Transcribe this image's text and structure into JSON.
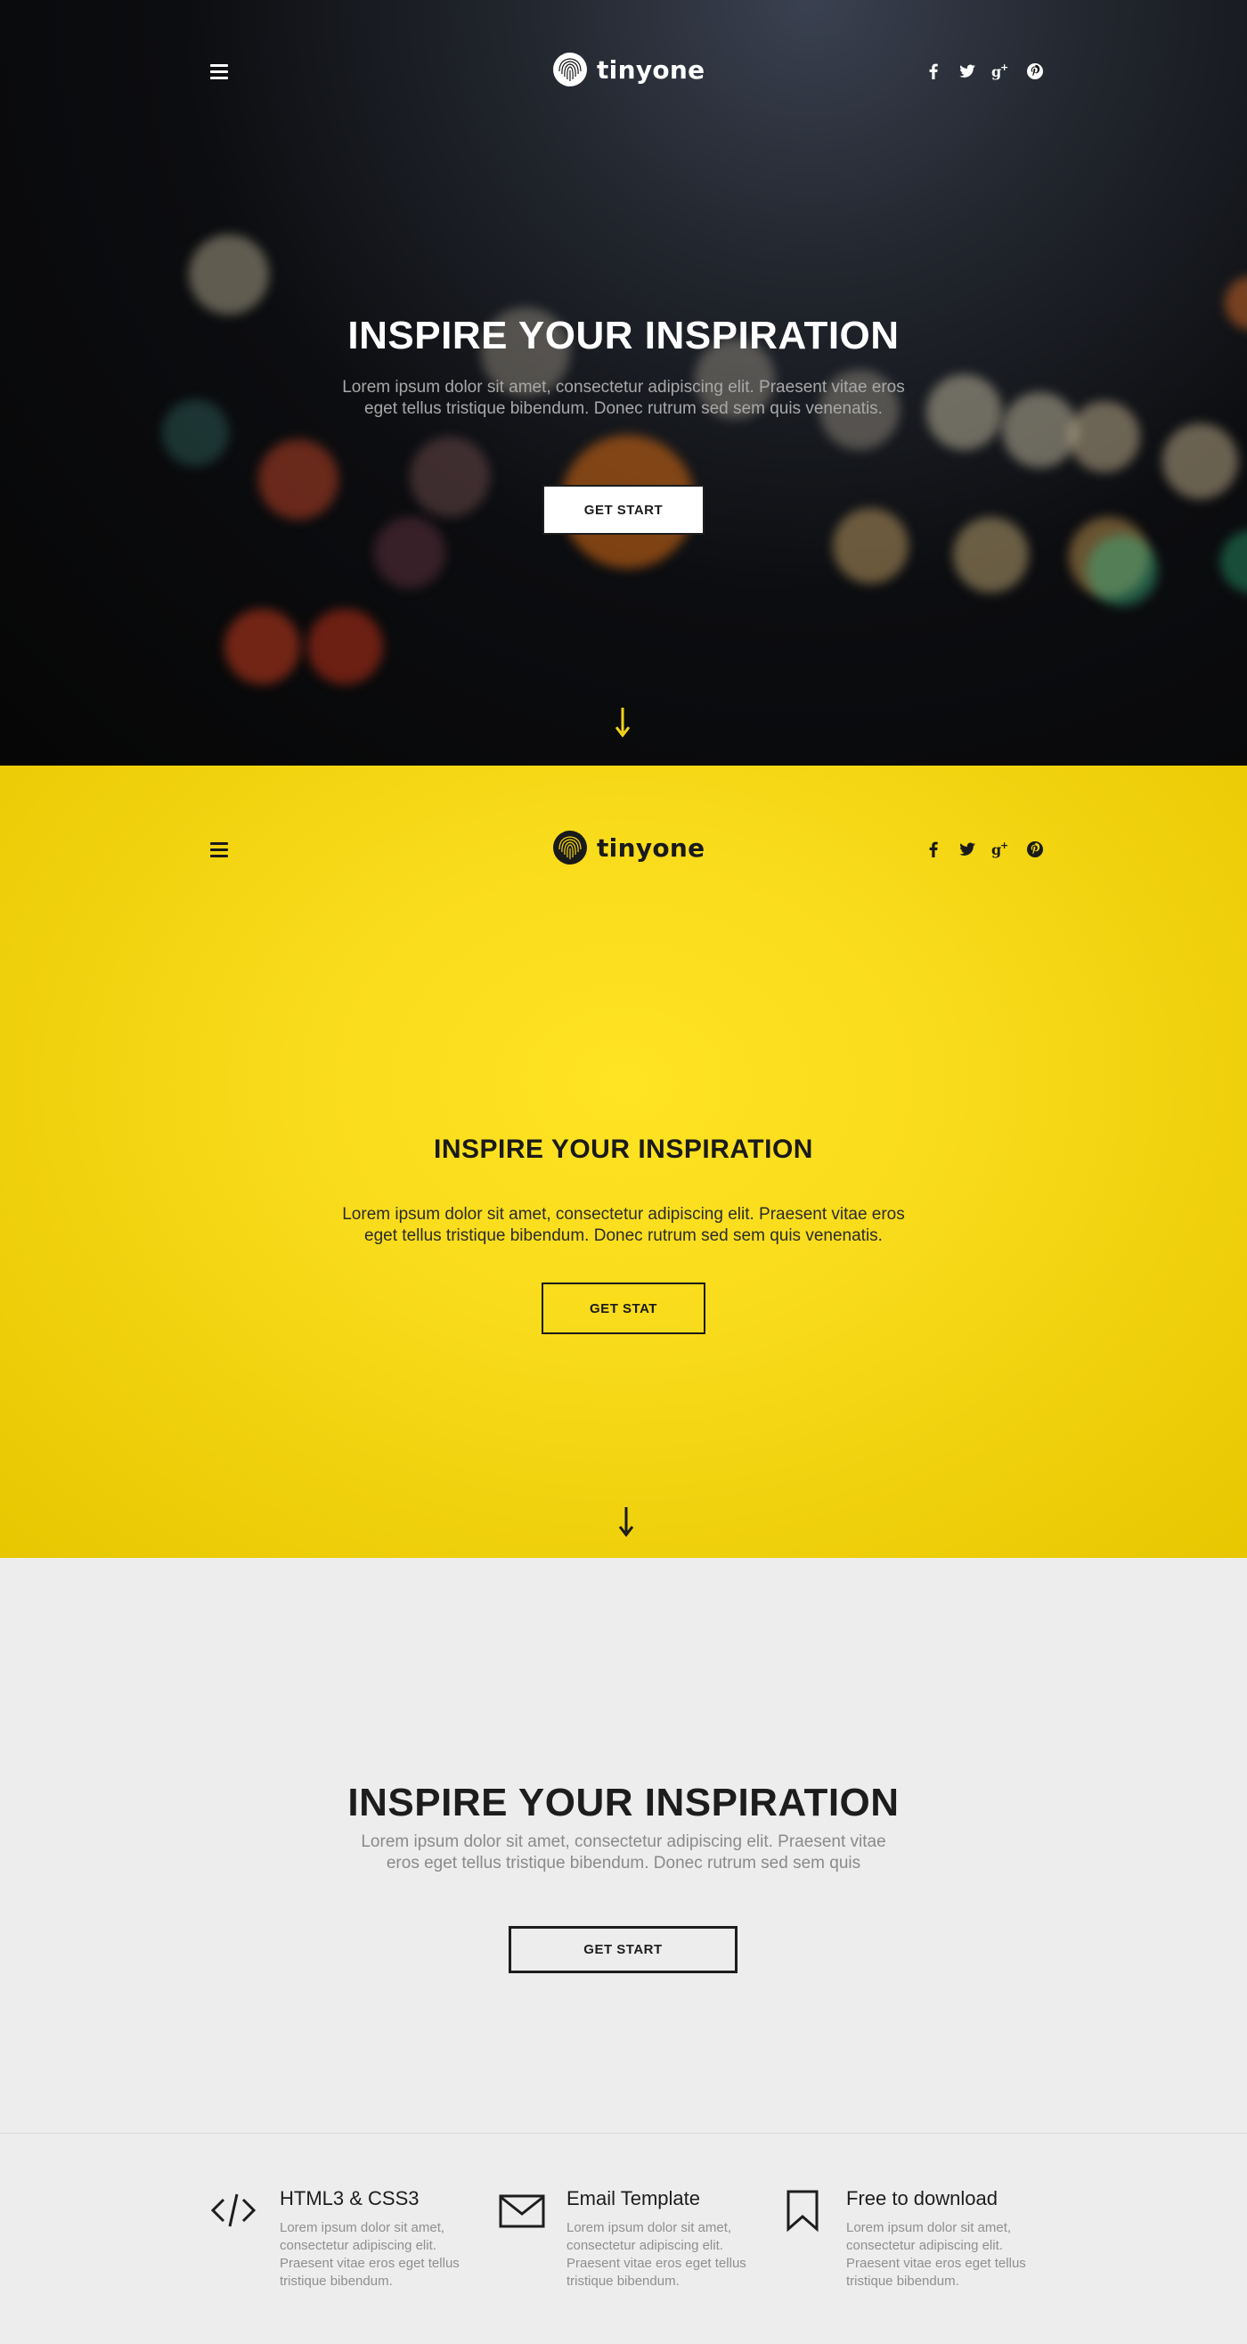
{
  "brand": {
    "name": "tinyone"
  },
  "social_icons": [
    "facebook-icon",
    "twitter-icon",
    "google-plus-icon",
    "pinterest-icon"
  ],
  "sections": {
    "dark": {
      "title": "INSPIRE YOUR INSPIRATION",
      "text": "Lorem ipsum dolor sit amet, consectetur adipiscing elit. Praesent vitae eros eget tellus tristique bibendum. Donec rutrum sed sem quis venenatis.",
      "button": "GET START",
      "accent": "#f2d41a"
    },
    "yellow": {
      "title": "INSPIRE YOUR INSPIRATION",
      "text": "Lorem ipsum dolor sit amet, consectetur adipiscing elit. Praesent vitae eros eget tellus tristique bibendum. Donec rutrum sed sem quis venenatis.",
      "button": "GET STAT",
      "accent": "#ffe01a"
    },
    "light": {
      "title": "INSPIRE YOUR INSPIRATION",
      "text": "Lorem ipsum dolor sit amet, consectetur adipiscing elit. Praesent vitae eros eget tellus tristique bibendum. Donec rutrum sed sem quis",
      "button": "GET START"
    }
  },
  "features": [
    {
      "icon": "code-icon",
      "title": "HTML3 & CSS3",
      "desc": "Lorem ipsum dolor sit amet, consectetur adipiscing elit. Praesent vitae eros eget tellus tristique bibendum."
    },
    {
      "icon": "envelope-icon",
      "title": "Email Template",
      "desc": "Lorem ipsum dolor sit amet, consectetur adipiscing elit. Praesent vitae eros eget tellus tristique bibendum."
    },
    {
      "icon": "bookmark-icon",
      "title": "Free to download",
      "desc": "Lorem ipsum dolor sit amet, consectetur adipiscing elit. Praesent vitae eros eget tellus tristique bibendum."
    }
  ]
}
